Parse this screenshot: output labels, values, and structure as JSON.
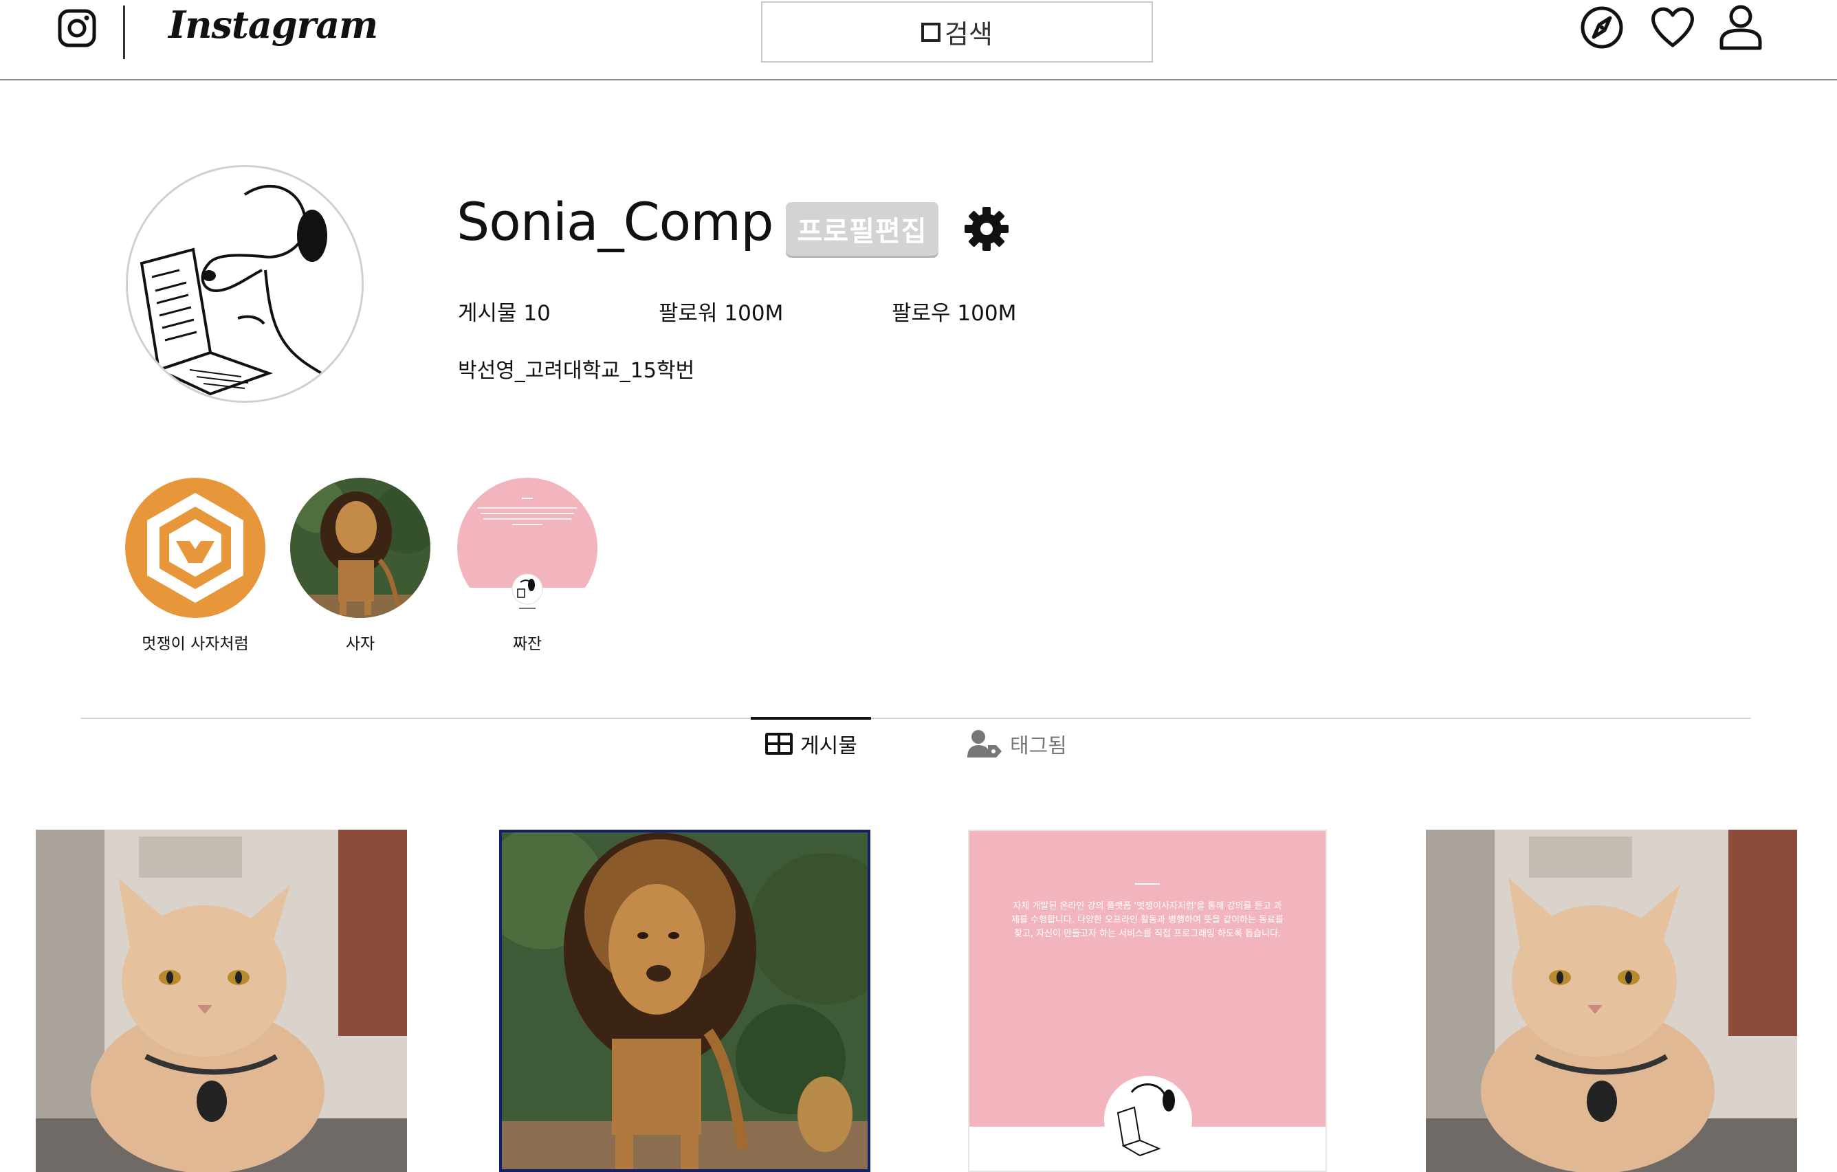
{
  "header": {
    "logo_wordmark": "Instagram",
    "search_placeholder": "검색",
    "icons": [
      "instagram-camera-icon",
      "explore-compass-icon",
      "heart-icon",
      "user-icon"
    ]
  },
  "profile": {
    "username": "Sonia_Comp",
    "edit_button_label": "프로필편집",
    "stats": {
      "posts": "게시물 10",
      "followers": "팔로워 100M",
      "following": "팔로우 100M"
    },
    "bio": "박선영_고려대학교_15학번"
  },
  "highlights": [
    {
      "label": "멋쟁이 사자처럼"
    },
    {
      "label": "사자"
    },
    {
      "label": "짜잔"
    }
  ],
  "tabs": [
    {
      "label": "게시물",
      "active": true
    },
    {
      "label": "태그됨",
      "active": false
    }
  ],
  "posts": [
    {
      "kind": "cat-photo"
    },
    {
      "kind": "lion-photo"
    },
    {
      "kind": "text-card",
      "text": "자체 개발된 온라인 강의 플랫폼 '멋쟁이사자처럼'을 통해 강의를 듣고 과제를 수행합니다. 다양한 오프라인 활동과 병행하여 뜻을 같이하는 동료를 찾고, 자신이 만들고자 하는 서비스를 직접 프로그래밍 하도록 돕습니다."
    },
    {
      "kind": "cat-photo"
    }
  ],
  "colors": {
    "accent_orange": "#e8963a",
    "card_pink": "#f3b5bd",
    "header_border": "#8a8a8a",
    "edit_button_bg": "#d3d3d3"
  }
}
